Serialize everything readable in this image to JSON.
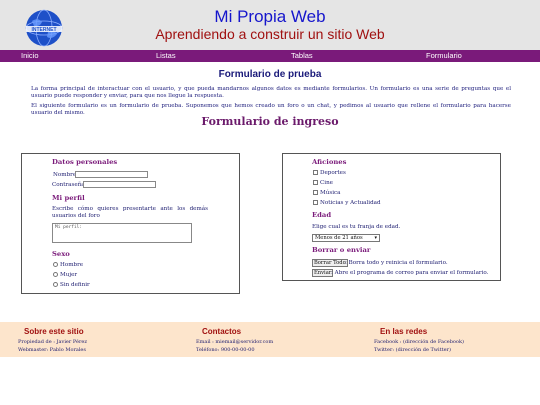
{
  "header": {
    "logo_text": "INTERNET",
    "title": "Mi Propia Web",
    "subtitle": "Aprendiendo a construir un sitio Web"
  },
  "nav": {
    "items": [
      {
        "label": "Inicio"
      },
      {
        "label": "Listas"
      },
      {
        "label": "Tablas"
      },
      {
        "label": "Formulario"
      }
    ]
  },
  "main": {
    "title": "Formulario de prueba",
    "para1": "La forma principal de interactuar con el usuario, y que pueda mandarnos algunos datos es mediante formularios. Un formulario es una serie de preguntas que el usuario puede responder y enviar, para que nos llegue la respuesta.",
    "para2": "El siguiente formulario es un formulario de prueba. Suponemos que hemos creado un foro o un chat, y pedimos al usuario que rellene el formulario para hacerse usuario del mismo.",
    "form_title": "Formulario de ingreso"
  },
  "form_left": {
    "datos_title": "Datos personales",
    "nombre_label": "Nombre:",
    "nombre_value": "",
    "password_label": "Contraseña:",
    "password_value": "",
    "perfil_title": "Mi perfil",
    "perfil_desc": "Escribe cómo quieres presentarte ante los demás usuarios del foro",
    "perfil_value": "Mi perfil:",
    "sexo_title": "Sexo",
    "sexo_options": [
      "Hombre",
      "Mujer",
      "Sin definir"
    ]
  },
  "form_right": {
    "aficiones_title": "Aficiones",
    "aficiones": [
      "Deportes",
      "Cine",
      "Música",
      "Noticias y Actualidad"
    ],
    "edad_title": "Edad",
    "edad_desc": "Elige cual es tu franja de edad.",
    "edad_selected": "Menos de 21 años",
    "enviar_title": "Borrar o enviar",
    "borrar_btn": "Borrar Todo",
    "borrar_desc": ": Borra todo y reinicia el formulario.",
    "enviar_btn": "Enviar",
    "enviar_desc": ": Abre el programa de correo para enviar el formulario."
  },
  "footer": {
    "col1_title": "Sobre este sitio",
    "col1_line1": "Propiedad de : Javier Pérez",
    "col1_line2": "Webmaster: Pablo Morales",
    "col2_title": "Contactos",
    "col2_line1": "Email : miemail@servidor.com",
    "col2_line2": "Teléfono: 900-00-00-00",
    "col3_title": "En las redes",
    "col3_line1": "Facebook : (dirección de Facebook)",
    "col3_line2": "Twitter: (dirección de Twitter)"
  },
  "colors": {
    "nav_bg": "#7a1a7a",
    "title_blue": "#1515cc",
    "subtitle_red": "#a01010",
    "footer_bg": "#fde5cc"
  }
}
